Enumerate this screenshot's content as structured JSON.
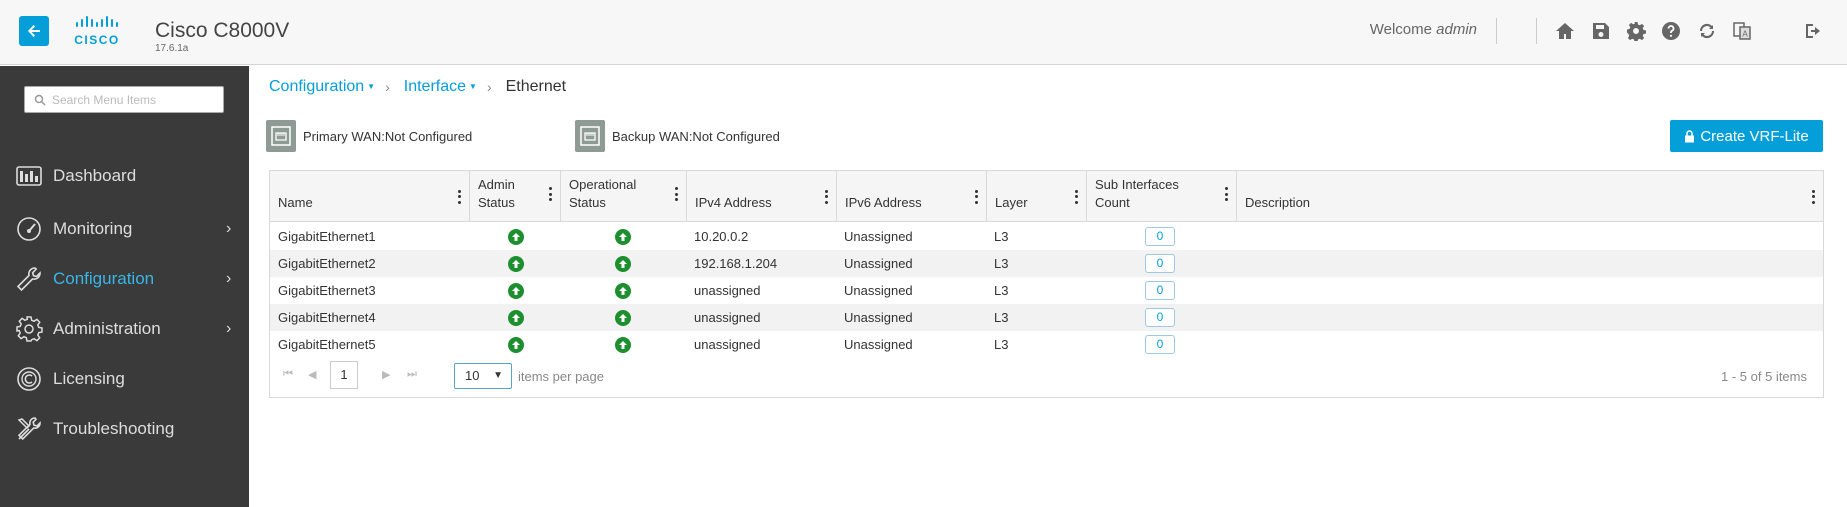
{
  "header": {
    "app_title": "Cisco C8000V",
    "version": "17.6.1a",
    "logo_text": "CISCO",
    "welcome_text": "Welcome",
    "username": "admin",
    "icons": [
      "back-arrow-icon",
      "home-icon",
      "save-icon",
      "gear-icon",
      "help-icon",
      "refresh-icon",
      "language-icon",
      "logout-icon"
    ],
    "accent_color": "#049fd9"
  },
  "sidebar": {
    "search_placeholder": "Search Menu Items",
    "items": [
      {
        "label": "Dashboard",
        "icon": "dashboard-icon",
        "has_submenu": false
      },
      {
        "label": "Monitoring",
        "icon": "gauge-icon",
        "has_submenu": true
      },
      {
        "label": "Configuration",
        "icon": "wrench-icon",
        "has_submenu": true,
        "active": true
      },
      {
        "label": "Administration",
        "icon": "gear-icon",
        "has_submenu": true
      },
      {
        "label": "Licensing",
        "icon": "licensing-icon",
        "has_submenu": false
      },
      {
        "label": "Troubleshooting",
        "icon": "tools-icon",
        "has_submenu": false
      }
    ],
    "background_color": "#3a3a3a",
    "active_color": "#39b6e6"
  },
  "breadcrumb": {
    "items": [
      "Configuration",
      "Interface"
    ],
    "current": "Ethernet"
  },
  "wan": {
    "primary": "Primary WAN:Not Configured",
    "backup": "Backup WAN:Not Configured"
  },
  "create_vrf_button": "Create VRF-Lite",
  "table": {
    "columns": [
      {
        "line1": "Name",
        "line2": ""
      },
      {
        "line1": "Admin",
        "line2": "Status"
      },
      {
        "line1": "Operational",
        "line2": "Status"
      },
      {
        "line1": "IPv4 Address",
        "line2": ""
      },
      {
        "line1": "IPv6 Address",
        "line2": ""
      },
      {
        "line1": "Layer",
        "line2": ""
      },
      {
        "line1": "Sub Interfaces",
        "line2": "Count"
      },
      {
        "line1": "Description",
        "line2": ""
      }
    ],
    "rows": [
      {
        "name": "GigabitEthernet1",
        "admin_status": "up",
        "oper_status": "up",
        "ipv4": "10.20.0.2",
        "ipv6": "Unassigned",
        "layer": "L3",
        "sub_count": "0",
        "description": ""
      },
      {
        "name": "GigabitEthernet2",
        "admin_status": "up",
        "oper_status": "up",
        "ipv4": "192.168.1.204",
        "ipv6": "Unassigned",
        "layer": "L3",
        "sub_count": "0",
        "description": ""
      },
      {
        "name": "GigabitEthernet3",
        "admin_status": "up",
        "oper_status": "up",
        "ipv4": "unassigned",
        "ipv6": "Unassigned",
        "layer": "L3",
        "sub_count": "0",
        "description": ""
      },
      {
        "name": "GigabitEthernet4",
        "admin_status": "up",
        "oper_status": "up",
        "ipv4": "unassigned",
        "ipv6": "Unassigned",
        "layer": "L3",
        "sub_count": "0",
        "description": ""
      },
      {
        "name": "GigabitEthernet5",
        "admin_status": "up",
        "oper_status": "up",
        "ipv4": "unassigned",
        "ipv6": "Unassigned",
        "layer": "L3",
        "sub_count": "0",
        "description": ""
      }
    ],
    "status_up_color": "#1e8f2e"
  },
  "pager": {
    "current_page": "1",
    "page_size": "10",
    "items_per_page_label": "items per page",
    "info": "1 - 5 of 5 items"
  }
}
